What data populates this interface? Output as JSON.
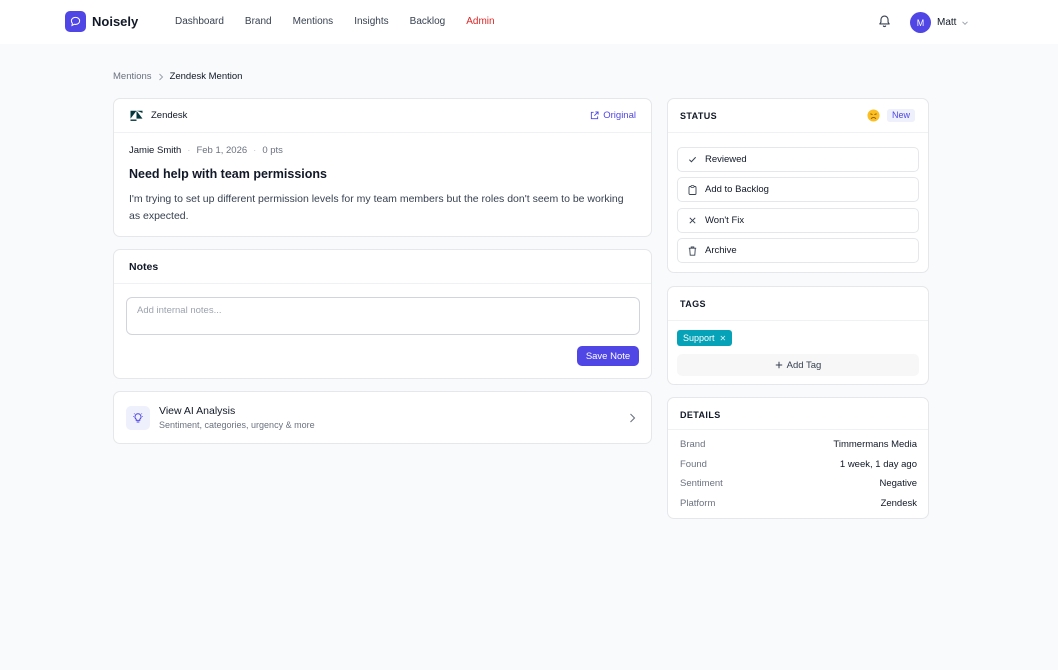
{
  "app": {
    "name": "Noisely"
  },
  "nav": {
    "items": [
      "Dashboard",
      "Brand",
      "Mentions",
      "Insights",
      "Backlog",
      "Admin"
    ]
  },
  "user": {
    "initial": "M",
    "name": "Matt"
  },
  "breadcrumb": {
    "parent": "Mentions",
    "current": "Zendesk Mention"
  },
  "mention": {
    "platform": "Zendesk",
    "original_label": "Original",
    "author": "Jamie Smith",
    "date": "Feb 1, 2026",
    "points": "0 pts",
    "title": "Need help with team permissions",
    "body": "I'm trying to set up different permission levels for my team members but the roles don't seem to be working as expected."
  },
  "notes": {
    "title": "Notes",
    "placeholder": "Add internal notes...",
    "save_label": "Save Note"
  },
  "ai": {
    "title": "View AI Analysis",
    "subtitle": "Sentiment, categories, urgency & more"
  },
  "status": {
    "title": "STATUS",
    "badge": "New",
    "actions": [
      "Reviewed",
      "Add to Backlog",
      "Won't Fix",
      "Archive"
    ]
  },
  "tags": {
    "title": "TAGS",
    "items": [
      "Support"
    ],
    "add_label": "Add Tag"
  },
  "details": {
    "title": "DETAILS",
    "rows": [
      {
        "key": "Brand",
        "value": "Timmermans Media"
      },
      {
        "key": "Found",
        "value": "1 week, 1 day ago"
      },
      {
        "key": "Sentiment",
        "value": "Negative"
      },
      {
        "key": "Platform",
        "value": "Zendesk"
      }
    ]
  },
  "colors": {
    "accent": "#4f46e5",
    "admin": "#dc2626",
    "tag": "#06a3b8"
  }
}
